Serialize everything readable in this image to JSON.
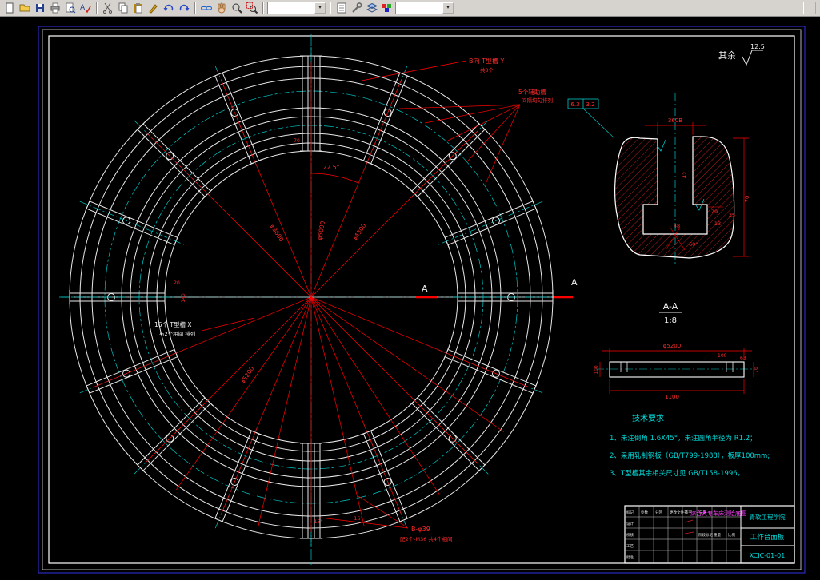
{
  "toolbar": {
    "icons": [
      "new-file",
      "open-file",
      "save",
      "print",
      "print-preview",
      "spell-check",
      "cut",
      "copy",
      "paste",
      "match-properties",
      "undo",
      "redo",
      "insert-hyperlink",
      "pan",
      "zoom",
      "zoom-window",
      "properties",
      "tools",
      "layers",
      "color-control",
      "app-button"
    ]
  },
  "drawing": {
    "roughness": {
      "label": "其余",
      "value": "12.5"
    },
    "main_view": {
      "labels": {
        "top_callout": "B向 T型槽 Y",
        "top_callout2": "共8个",
        "aux_callout": "5个辅助槽",
        "aux_callout2": "间隔均匀排列",
        "left_callout1": "16个 T型槽 X",
        "left_callout2": "与2个相间 排列",
        "bottom_callout1": "B-φ39",
        "bottom_callout2": "配2个-M36 共4个相间",
        "section_a_left": "A",
        "section_a_right": "A"
      },
      "dims": {
        "dia1": "φ3600",
        "dia2": "φ5000",
        "dia3": "φ4300",
        "dia4": "φ5200",
        "ang1": "22.5°",
        "ang2": "15°",
        "ang3": "16°",
        "slot_w": "70",
        "slot_l1": "140",
        "slot_l2": "20"
      }
    },
    "detail_view": {
      "spec_box": [
        "6.3",
        "3.2"
      ],
      "dims": {
        "top": "360B",
        "right": "70",
        "angle": "60°",
        "d42": "42",
        "d29": "29",
        "d25": "25",
        "d13": "13",
        "d48": "48"
      }
    },
    "section_view": {
      "title": "A-A",
      "scale": "1:8",
      "dims": {
        "dia": "φ5200",
        "len": "1100",
        "h_left": "100",
        "h_right": "70",
        "d100": "100",
        "d63": "63"
      }
    },
    "tech_req": {
      "title": "技术要求",
      "items": [
        "1、未注倒角 1.6X45°，未注圆角半径为 R1.2；",
        "2、采用轧制钢板（GB/T799-1988），板厚100mm;",
        "3、T型槽其余相关尺寸见 GB/T158-1996。"
      ]
    },
    "title_block": {
      "company": "青软工程学院",
      "project": "综合大专车床测绘底图",
      "part_name": "工作台面板",
      "drawing_no": "XCJC-01-01",
      "cells": {
        "mark": "标记",
        "count": "处数",
        "zone": "分区",
        "change": "更改文件号",
        "sign": "签字",
        "date": "日期",
        "design": "设计",
        "check": "校核",
        "process": "工艺",
        "approve": "批准",
        "stage": "阶段标记",
        "weight": "重量",
        "scale": "比例"
      }
    }
  }
}
